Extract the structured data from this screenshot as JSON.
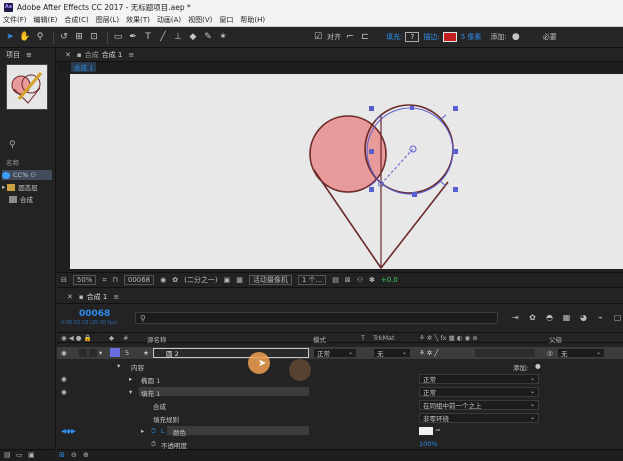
{
  "window": {
    "title": "Adobe After Effects CC 2017 - 无标题项目.aep *"
  },
  "menu": [
    "文件(F)",
    "编辑(E)",
    "合成(C)",
    "图层(L)",
    "效果(T)",
    "动画(A)",
    "视图(V)",
    "窗口",
    "帮助(H)"
  ],
  "toolbar": {
    "snap_label": "对齐",
    "fill_label": "填充:",
    "fill_value": "?",
    "stroke_label": "描边:",
    "stroke_width": "5 像素",
    "add_label": "添加:",
    "essentials": "必要"
  },
  "project_panel": {
    "tab_label": "项目",
    "menu_icon": "≡",
    "name_header": "名称",
    "items": [
      "CC%",
      "固态层",
      "合成"
    ]
  },
  "composition_panel": {
    "tab_prefix": "合成",
    "tab_name": "合成 1",
    "breadcrumb": "合成 1"
  },
  "viewer_bar": {
    "zoom": "50%",
    "timecode": "00068",
    "resolution": "(二分之一)",
    "camera": "活动摄像机",
    "views": "1 个...",
    "exposure": "+0.0"
  },
  "timeline": {
    "tab_name": "合成 1",
    "timecode": "00068",
    "timecode_sub": "0:00:02:18 (25.00 fps)",
    "search_placeholder": "",
    "columns": {
      "num": "#",
      "source": "源名称",
      "mode": "模式",
      "t": "T",
      "trkmat": "TrkMat",
      "parent": "父级"
    },
    "layer": {
      "num": "5",
      "name": "圆 2",
      "mode": "正常",
      "trkmat": "无",
      "parent": "无"
    },
    "rows": {
      "contents": "内容",
      "add": "添加:",
      "ellipse": "椭圆 1",
      "ellipse_mode": "正常",
      "fill": "填充 1",
      "fill_mode": "正常",
      "composite": "合成",
      "composite_value": "在同组中前一个之上",
      "fill_rule": "填充规则",
      "fill_rule_value": "非零环绕",
      "color": "颜色",
      "opacity": "不透明度",
      "opacity_value": "100%"
    }
  },
  "colors": {
    "accent": "#2d8ceb",
    "heart_fill": "#e99a9a",
    "heart_stroke": "#6b2a2a",
    "path_handles": "#5a5fd0",
    "label_purple": "#6a6de0",
    "cursor_orange": "#f0a050"
  }
}
